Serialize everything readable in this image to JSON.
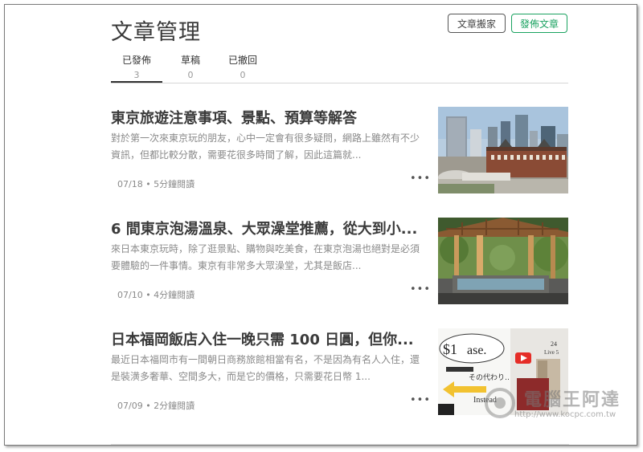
{
  "header": {
    "page_title": "文章管理",
    "move_button": "文章搬家",
    "publish_button": "發佈文章"
  },
  "tabs": [
    {
      "label": "已發佈",
      "count": "3"
    },
    {
      "label": "草稿",
      "count": "0"
    },
    {
      "label": "已撤回",
      "count": "0"
    }
  ],
  "articles": [
    {
      "title": "東京旅遊注意事項、景點、預算等解答",
      "excerpt": "對於第一次來東京玩的朋友，心中一定會有很多疑問，網路上雖然有不少資訊，但都比較分散，需要花很多時間了解，因此這篇就...",
      "meta": "07/18 • 5分鐘閱讀",
      "more": "•••",
      "thumb": "tokyo-station-cityscape"
    },
    {
      "title": "6 間東京泡湯溫泉、大眾澡堂推薦，從大到小...",
      "excerpt": "來日本東京玩時，除了逛景點、購物與吃美食，在東京泡湯也絕對是必須要體驗的一件事情。東京有非常多大眾澡堂，尤其是飯店...",
      "meta": "07/10 • 4分鐘閱讀",
      "more": "•••",
      "thumb": "outdoor-hot-spring-pavilion"
    },
    {
      "title": "日本福岡飯店入住一晚只需 100 日圓，但你...",
      "excerpt": "最近日本福岡市有一間朝日商務旅館相當有名，不是因為有名人入住，還是裝潢多奢華、空間多大，而是它的價格，只需要花日幣 1...",
      "meta": "07/09 • 2分鐘閱讀",
      "more": "•••",
      "thumb": "hotel-video-collage",
      "thumb_text": {
        "price": "$1",
        "word": "ase.",
        "caption": "その代わり…",
        "instead": "Instead",
        "side1": "24",
        "side2": "Live 5"
      }
    }
  ],
  "watermark": {
    "text": "電腦王阿達",
    "url": "http://www.kocpc.com.tw"
  },
  "colors": {
    "publish_accent": "#1aa260",
    "text_dark": "#3a3a3a",
    "text_muted": "#8a8a8a"
  }
}
